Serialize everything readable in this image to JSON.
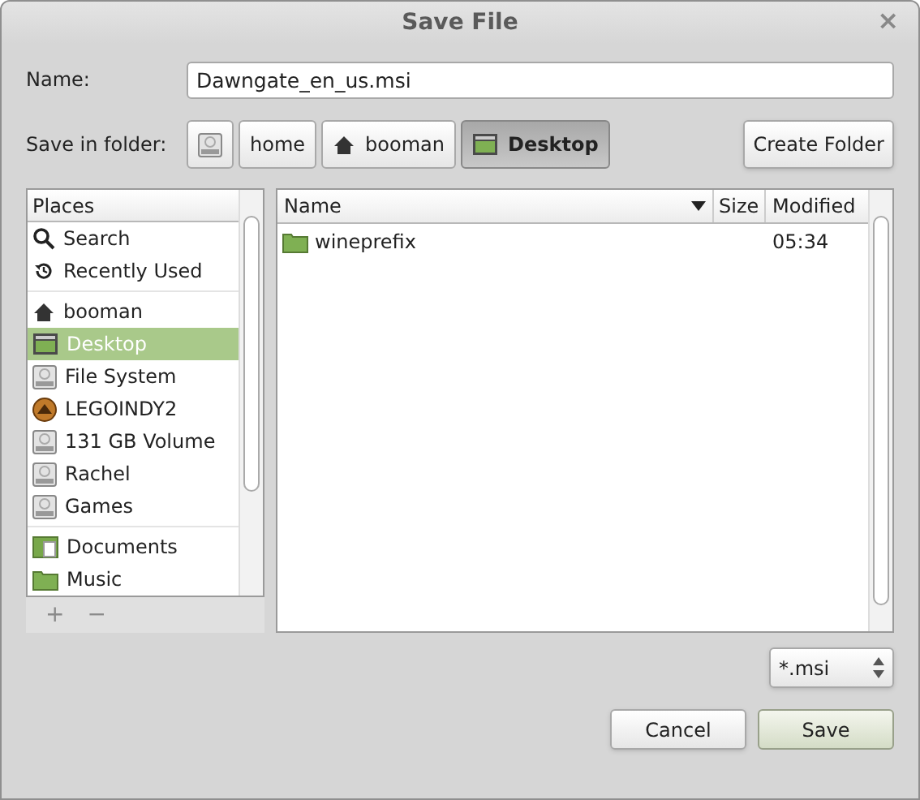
{
  "window": {
    "title": "Save File",
    "close": "×"
  },
  "name_field": {
    "label": "Name:",
    "value": "Dawngate_en_us.msi"
  },
  "save_in": {
    "label": "Save in folder:",
    "path": [
      {
        "kind": "drive",
        "selected": false
      },
      {
        "kind": "folder",
        "label": "home",
        "selected": false
      },
      {
        "kind": "home",
        "label": "booman",
        "selected": false
      },
      {
        "kind": "desktop",
        "label": "Desktop",
        "selected": true
      }
    ]
  },
  "create_folder": "Create Folder",
  "places": {
    "heading": "Places",
    "groups": [
      [
        {
          "kind": "search",
          "label": "Search",
          "selected": false
        },
        {
          "kind": "recent",
          "label": "Recently Used",
          "selected": false
        }
      ],
      [
        {
          "kind": "home",
          "label": "booman",
          "selected": false
        },
        {
          "kind": "desktop",
          "label": "Desktop",
          "selected": true
        },
        {
          "kind": "drive",
          "label": "File System",
          "selected": false
        },
        {
          "kind": "disc",
          "label": "LEGOINDY2",
          "selected": false
        },
        {
          "kind": "drive",
          "label": "131 GB Volume",
          "selected": false
        },
        {
          "kind": "drive",
          "label": "Rachel",
          "selected": false
        },
        {
          "kind": "drive",
          "label": "Games",
          "selected": false
        }
      ],
      [
        {
          "kind": "documents",
          "label": "Documents",
          "selected": false
        },
        {
          "kind": "folder",
          "label": "Music",
          "selected": false
        }
      ]
    ],
    "add": "+",
    "remove": "−"
  },
  "files": {
    "columns": [
      "Name",
      "Size",
      "Modified"
    ],
    "rows": [
      {
        "name": "wineprefix",
        "modified": "05:34"
      }
    ]
  },
  "filter": "*.msi",
  "buttons": {
    "cancel": "Cancel",
    "save": "Save"
  }
}
